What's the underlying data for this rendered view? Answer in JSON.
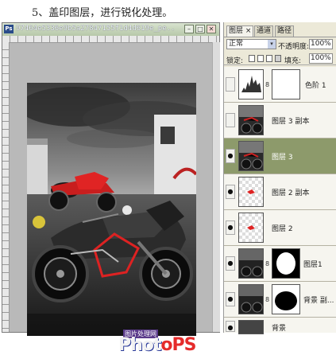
{
  "caption": "5、盖印图层，进行锐化处理。",
  "document": {
    "title": "97464e5336e9b5a27847155f1d4d619e_pe...",
    "app_icon": "Ps",
    "controls": [
      "minimize-icon",
      "maximize-icon",
      "close-icon"
    ],
    "minimize_glyph": "–",
    "maximize_glyph": "□",
    "close_glyph": "✕"
  },
  "watermark": {
    "sub": "图片处理网",
    "main_part1": "Phot",
    "main_part2": "oPS"
  },
  "panel": {
    "tabs": [
      "图层",
      "通道",
      "路径"
    ],
    "tab_close": "×",
    "blend_mode": "正常",
    "opacity_label": "不透明度:",
    "opacity_value": "100%",
    "lock_label": "锁定:",
    "fill_label": "填充:",
    "fill_value": "100%",
    "dropdown_arrow": "▾",
    "link_glyph": "8",
    "eye_glyph": "●",
    "layers": [
      {
        "name": "色阶 1",
        "visible": false,
        "thumb": "levels-icon",
        "has_mask": true,
        "selected": false
      },
      {
        "name": "图层 3 副本",
        "visible": false,
        "thumb": "photo",
        "has_mask": false,
        "selected": false
      },
      {
        "name": "图层 3",
        "visible": true,
        "thumb": "photo",
        "has_mask": false,
        "selected": true
      },
      {
        "name": "图层 2 副本",
        "visible": true,
        "thumb": "transparent",
        "has_mask": false,
        "selected": false
      },
      {
        "name": "图层 2",
        "visible": true,
        "thumb": "transparent",
        "has_mask": false,
        "selected": false
      },
      {
        "name": "图层1",
        "visible": true,
        "thumb": "photo",
        "has_mask": true,
        "selected": false
      },
      {
        "name": "背景 副...",
        "visible": true,
        "thumb": "photo",
        "has_mask": true,
        "selected": false
      },
      {
        "name": "背景",
        "visible": true,
        "thumb": "photo",
        "has_mask": false,
        "selected": false
      }
    ]
  },
  "colors": {
    "selected_layer": "#8d9a6b",
    "panel_bg": "#ece9d8",
    "canvas_bg": "#b9b9b9"
  }
}
